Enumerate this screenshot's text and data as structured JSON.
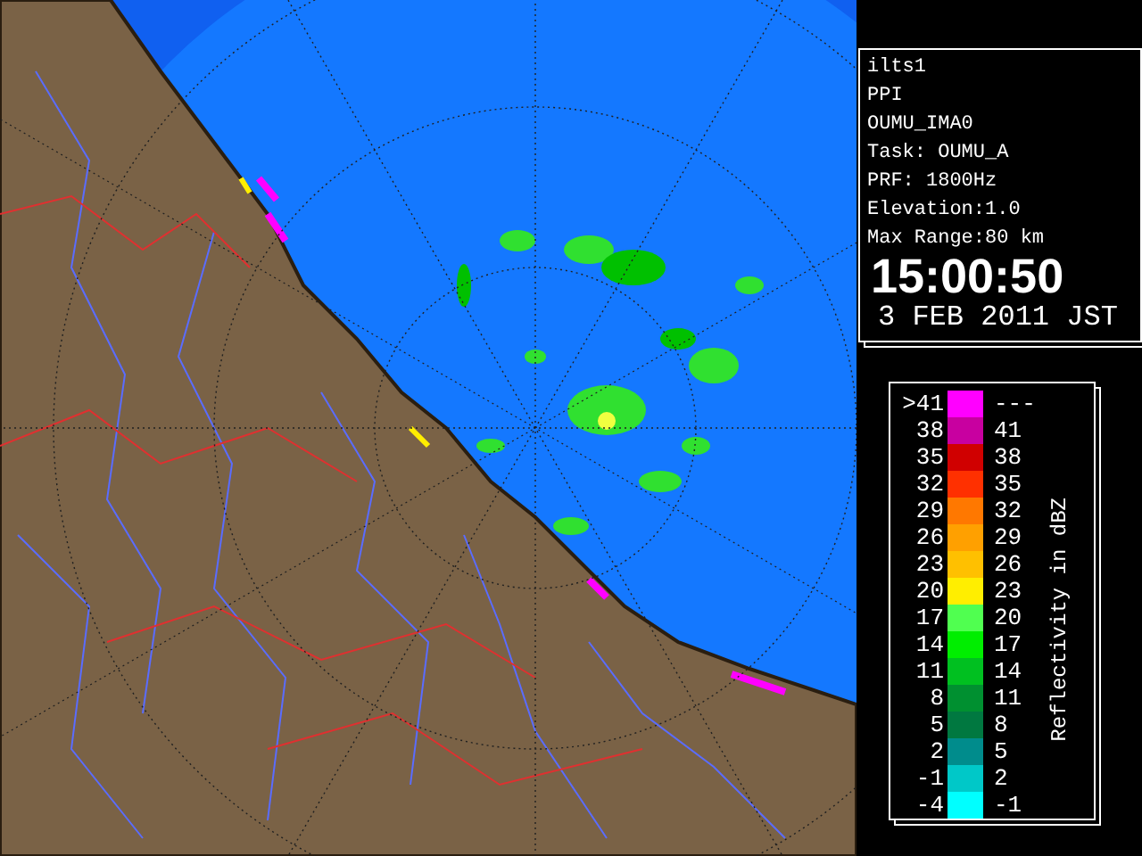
{
  "info": {
    "lines": [
      "ilts1",
      "PPI",
      "OUMU_IMA0",
      "Task: OUMU_A",
      "PRF: 1800Hz",
      "Elevation:1.0",
      "Max Range:80 km"
    ],
    "time": "15:00:50",
    "date": "3 FEB 2011 JST"
  },
  "legend": {
    "title": "Reflectivity in dBZ",
    "rows": [
      {
        "low": ">41",
        "high": "---",
        "color": "#ff00ff"
      },
      {
        "low": "38",
        "high": "41",
        "color": "#c800a0"
      },
      {
        "low": "35",
        "high": "38",
        "color": "#d00000"
      },
      {
        "low": "32",
        "high": "35",
        "color": "#ff3000"
      },
      {
        "low": "29",
        "high": "32",
        "color": "#ff7800"
      },
      {
        "low": "26",
        "high": "29",
        "color": "#ffa000"
      },
      {
        "low": "23",
        "high": "26",
        "color": "#ffc000"
      },
      {
        "low": "20",
        "high": "23",
        "color": "#ffee00"
      },
      {
        "low": "17",
        "high": "20",
        "color": "#50ff50"
      },
      {
        "low": "14",
        "high": "17",
        "color": "#00ee00"
      },
      {
        "low": "11",
        "high": "14",
        "color": "#00c020"
      },
      {
        "low": "8",
        "high": "11",
        "color": "#009030"
      },
      {
        "low": "5",
        "high": "8",
        "color": "#007840"
      },
      {
        "low": "2",
        "high": "5",
        "color": "#008c8c"
      },
      {
        "low": "-1",
        "high": "2",
        "color": "#00c8c8"
      },
      {
        "low": "-4",
        "high": "-1",
        "color": "#00ffff"
      }
    ]
  }
}
